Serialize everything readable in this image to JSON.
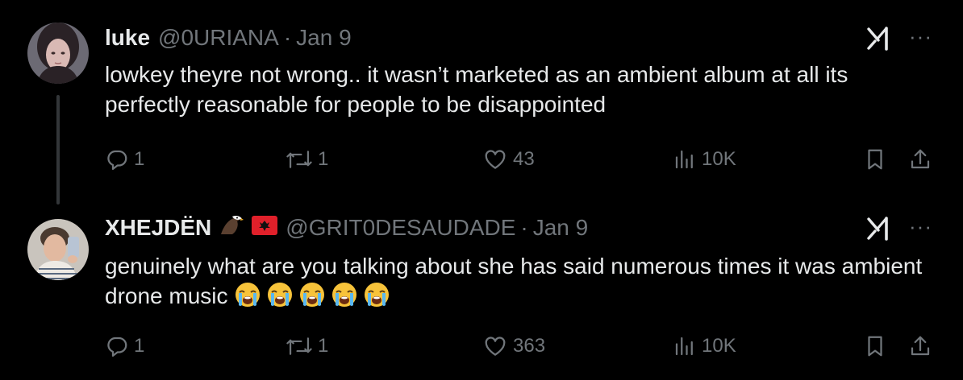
{
  "tweets": [
    {
      "author_name": "luke",
      "handle": "@0URIANA",
      "separator": "·",
      "date": "Jan 9",
      "text": "lowkey theyre not wrong.. it wasn’t marketed as an ambient album at all its perfectly reasonable for people to be disappointed",
      "replies": "1",
      "reposts": "1",
      "likes": "43",
      "views": "10K"
    },
    {
      "author_name": "XHEJDËN",
      "name_emojis": [
        "eagle-emoji",
        "albania-flag-emoji"
      ],
      "handle": "@GRIT0DESAUDADE",
      "separator": "·",
      "date": "Jan 9",
      "text": "genuinely what are you talking about she has said numerous times it was ambient drone music",
      "trailing_emojis": [
        "loudly-crying-face",
        "loudly-crying-face",
        "loudly-crying-face",
        "loudly-crying-face",
        "loudly-crying-face"
      ],
      "replies": "1",
      "reposts": "1",
      "likes": "363",
      "views": "10K"
    }
  ],
  "more_label": "···",
  "colors": {
    "background": "#000000",
    "text": "#e7e9ea",
    "muted": "#71767b",
    "thread_line": "#333639"
  }
}
